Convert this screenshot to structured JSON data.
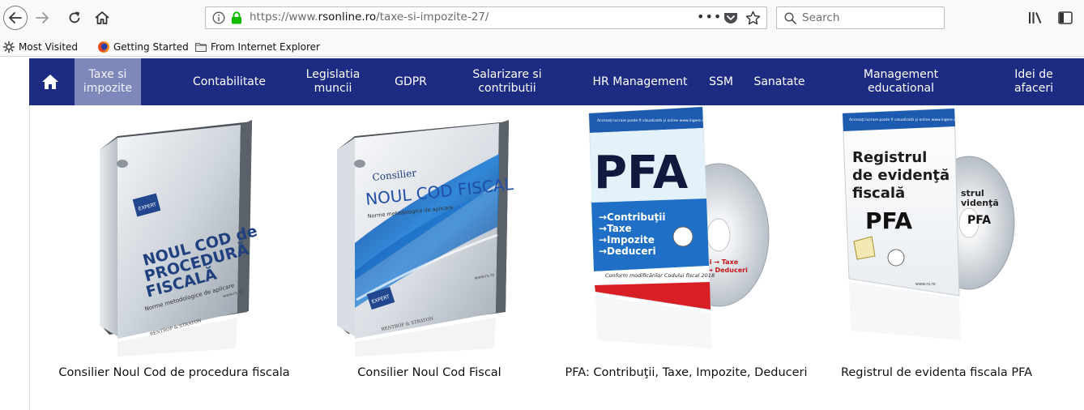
{
  "browser": {
    "url_prefix": "https://www.",
    "url_domain": "rsonline.ro",
    "url_path": "/taxe-si-impozite-27/",
    "url_more": "•••",
    "search_placeholder": "Search"
  },
  "bookmarks": [
    {
      "label": "Most Visited",
      "icon": "gear-icon"
    },
    {
      "label": "Getting Started",
      "icon": "firefox-icon"
    },
    {
      "label": "From Internet Explorer",
      "icon": "folder-icon"
    }
  ],
  "nav": {
    "items": [
      {
        "label": "Taxe si impozite",
        "active": true
      },
      {
        "label": "Contabilitate"
      },
      {
        "label": "Legislatia muncii"
      },
      {
        "label": "GDPR"
      },
      {
        "label": "Salarizare si contributii"
      },
      {
        "label": "HR Management"
      },
      {
        "label": "SSM"
      },
      {
        "label": "Sanatate"
      },
      {
        "label": "Management educational"
      },
      {
        "label": "Idei de afaceri"
      }
    ]
  },
  "products": [
    {
      "title": "Consilier Noul Cod de procedura fiscala",
      "cover_lines": [
        "NOUL COD de",
        "PROCEDURĂ",
        "FISCALĂ"
      ],
      "cover_sub": "Norme metodologice de aplicare",
      "badge": "EXPERT",
      "publisher": "RENTROP & STRATON",
      "site": "www.rs.ro"
    },
    {
      "title": "Consilier Noul Cod Fiscal",
      "cover_kicker": "Consilier",
      "cover_lines": [
        "NOUL COD FISCAL"
      ],
      "cover_sub": "Norme metodologice de aplicare",
      "badge": "EXPERT",
      "publisher": "RENTROP & STRATON",
      "site": "www.rs.ro"
    },
    {
      "title": "PFA: Contribuţii, Taxe, Impozite, Deduceri",
      "banner": "Accesaţi lucrare poate fi vizualizată şi online www.ingere.ro",
      "cover_big": "PFA",
      "cover_lines": [
        "→Contribuţii",
        "→Taxe",
        "→Impozite",
        "→Deduceri"
      ],
      "cover_sub": "Conform modificărilor Codului fiscal 2018",
      "disc_lines": [
        "ii → Taxe",
        "→ Deduceri"
      ]
    },
    {
      "title": "Registrul de evidenta fiscala PFA",
      "banner": "Accesaţi lucrare poate fi vizualizată şi online www.ingere.ro",
      "cover_lines": [
        "Registrul",
        "de evidenţă",
        "fiscală"
      ],
      "cover_big": "PFA",
      "disc_lines": [
        "strul",
        "videnţă",
        "PFA"
      ],
      "site": "www.rs.ro"
    }
  ]
}
